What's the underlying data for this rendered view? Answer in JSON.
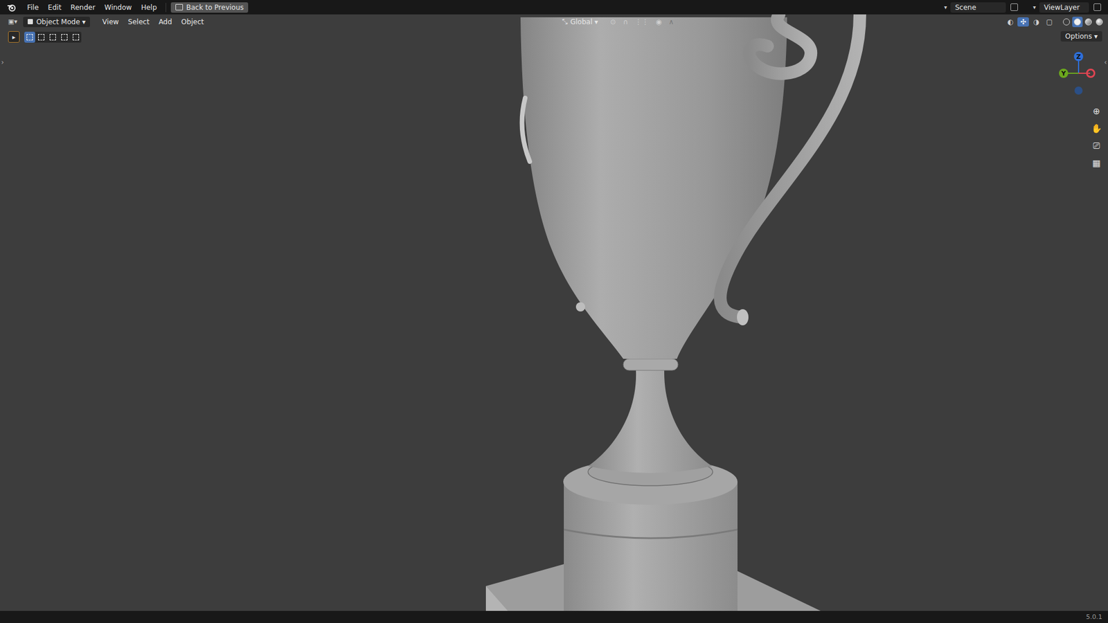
{
  "topbar": {
    "menus": [
      "File",
      "Edit",
      "Render",
      "Window",
      "Help"
    ],
    "back_button": "Back to Previous",
    "scene": "Scene",
    "view_layer": "ViewLayer"
  },
  "header": {
    "mode": "Object Mode",
    "menus": [
      "View",
      "Select",
      "Add",
      "Object"
    ],
    "orientation": "Global"
  },
  "select_modes": [
    {
      "selected": true
    },
    {
      "selected": false
    },
    {
      "selected": false
    },
    {
      "selected": false
    },
    {
      "selected": false
    }
  ],
  "shading_modes": [
    {
      "selected": false
    },
    {
      "selected": true
    },
    {
      "selected": false
    },
    {
      "selected": false
    }
  ],
  "toggles": {
    "gizmos": true,
    "overlays": false
  },
  "options": "Options",
  "gizmo": {
    "z": "Z",
    "y": "Y"
  },
  "status_bar": {
    "version": "5.0.1"
  }
}
